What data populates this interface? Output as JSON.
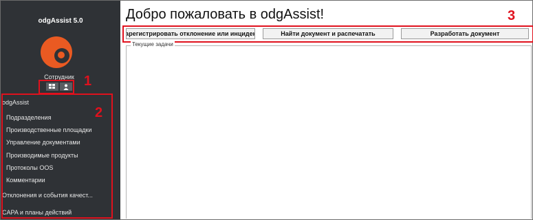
{
  "sidebar": {
    "app_title": "odgAssist 5.0",
    "role": "Сотрудник",
    "icons": {
      "dashboard": "grid-icon",
      "profile": "user-icon"
    },
    "menu_root": "odgAssist",
    "items": [
      "Подразделения",
      "Производственные площадки",
      "Управление документами",
      "Производимые продукты",
      "Протоколы OOS",
      "Комментарии"
    ],
    "sections": [
      "Отклонения и события качест...",
      "CAPA и планы действий"
    ]
  },
  "main": {
    "welcome": "Добро пожаловать в odgAssist!",
    "quick_actions": [
      "Зарегистрировать отклонение или инцидент",
      "Найти документ и распечатать",
      "Разработать документ"
    ],
    "tasks_title": "Текущие задачи"
  },
  "annotations": [
    "1",
    "2",
    "3"
  ],
  "colors": {
    "sidebar_bg": "#2f3236",
    "logo": "#ea5a22",
    "highlight": "#e0111d"
  }
}
